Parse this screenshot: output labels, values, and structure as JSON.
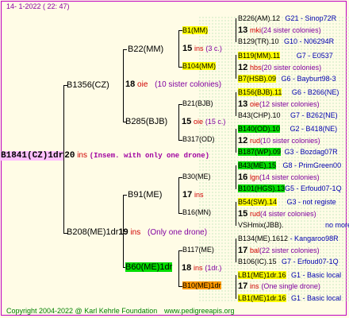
{
  "header": {
    "text": "14-   1-2022  ( 22:  47)"
  },
  "root": {
    "name": "B1841(CZ)1dr",
    "num": "20",
    "code": "ins",
    "note": "(Insem. with only one drone)"
  },
  "p1": {
    "name": "B1356(CZ)",
    "num": "18",
    "code": "oie",
    "note": "(10 sister colonies)"
  },
  "p2": {
    "name": "B208(ME)1dr",
    "num": "19",
    "code": "ins",
    "note": "(Only one drone)"
  },
  "g1": {
    "name": "B22(MM)"
  },
  "g2": {
    "name": "B285(BJB)",
    "num": "15",
    "code": "oie",
    "note": "(15 c.)"
  },
  "g3": {
    "name": "B91(ME)",
    "num": "17",
    "code": "ins"
  },
  "g4": {
    "name": "B60(ME)1dr",
    "num": "18",
    "code": "ins",
    "note": "(1dr.)"
  },
  "gg": [
    {
      "name": "B1(MM)",
      "num": "15",
      "code": "ins",
      "note": "(3 c.)"
    },
    {
      "name": "B104(MM)"
    },
    {
      "name": "B21(BJB)"
    },
    {
      "name": "B317(OD)"
    },
    {
      "name": "B30(ME)"
    },
    {
      "name": "B16(MN)"
    },
    {
      "name": "B117(ME)",
      "num": "18",
      "code": "ins",
      "note": "(1dr.)"
    },
    {
      "name": "B10(ME)1dr",
      "num": "17",
      "code": "ins",
      "note": "(One single drone)"
    }
  ],
  "right": [
    {
      "name": "B226(AM).12",
      "ref": "G21 - Sinop72R"
    },
    {
      "num": "13",
      "code": "mki",
      "note": "(24 sister colonies)"
    },
    {
      "name": "B129(TR).10",
      "ref": "G10 - N06294R"
    },
    {
      "name": "B119(MM).11",
      "ref": "G7 - E0537"
    },
    {
      "num": "12",
      "code": "hbs",
      "note": "(20 sister colonies)"
    },
    {
      "name": "B7(HSB).09",
      "ref": "G6 - Bayburt98-3"
    },
    {
      "name": "B156(BJB).11",
      "ref": "G6 - B266(NE)"
    },
    {
      "num": "13",
      "code": "oie",
      "note": "(12 sister colonies)"
    },
    {
      "name": "B43(CHP).10",
      "ref": "G7 - B262(NE)"
    },
    {
      "name": "B140(OD).10",
      "ref": "G2 - B418(NE)"
    },
    {
      "num": "12",
      "code": "rud",
      "note": "(10 sister colonies)"
    },
    {
      "name": "B187(WP).09",
      "ref": "G3 - Bozdag07R"
    },
    {
      "name": "B43(ME).15",
      "ref": "G8 - PrimGreen00"
    },
    {
      "num": "16",
      "code": "lgn",
      "note": "(14 sister colonies)"
    },
    {
      "name": "B101(HGS).13",
      "ref": "G5 - Erfoud07-1Q"
    },
    {
      "name": "B54(SW).14",
      "ref": "G3 - not registe"
    },
    {
      "num": "15",
      "code": "rud",
      "note": "(4 sister colonies)"
    },
    {
      "name": "VSHmix(JBB).",
      "ref": "no more"
    },
    {
      "name": "B134(ME).1612",
      "ref": "- Kangaroo98R"
    },
    {
      "num": "17",
      "code": "bal",
      "note": "(22 sister colonies)"
    },
    {
      "name": "B106(IC).15",
      "ref": "G7 - Erfoud07-1Q"
    },
    {
      "name": "LB1(ME)1dr.16",
      "ref": "G1 - Basic local"
    },
    {
      "num": "17",
      "code": "ins",
      "note": "(One single drone)"
    },
    {
      "name": "LB1(ME)1dr.16",
      "ref": "G1 - Basic local"
    }
  ],
  "footer": {
    "copyright": "Copyright 2004-2022 @ Karl Kehrle Foundation",
    "url": "www.pedigreeapis.org"
  }
}
